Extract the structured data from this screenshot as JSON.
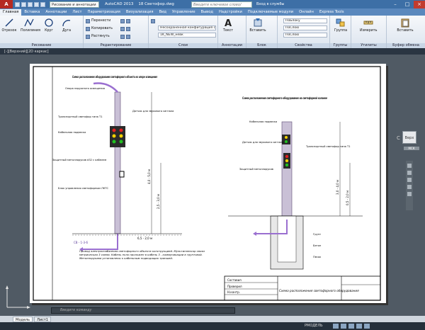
{
  "titlebar": {
    "logo": "A",
    "workspace": "Рисование и аннотации",
    "window_title_app": "AutoCAD 2013",
    "window_title_file": "18 Светофор.dwg",
    "search_placeholder": "Введите ключевое слово/фразу",
    "login": "Вход в службы"
  },
  "tabs": [
    "Главная",
    "Вставка",
    "Аннотации",
    "Лист",
    "Параметризация",
    "Визуализация",
    "Вид",
    "Управление",
    "Вывод",
    "Надстройки",
    "Подключаемые модули",
    "Онлайн",
    "Express Tools"
  ],
  "ribbon": {
    "draw": {
      "title": "Рисование",
      "line": "Отрезок",
      "polyline": "Полилиния",
      "circle": "Круг",
      "arc": "Дуга"
    },
    "modify": {
      "title": "Редактирование",
      "move": "Перенести",
      "copy": "Копировать",
      "stretch": "Растянуть"
    },
    "layers": {
      "title": "Слои",
      "layer_state": "Несохраненная конфигурация сло",
      "current_layer": "1K_NEW_невк"
    },
    "annotation": {
      "title": "Аннотации",
      "text": "Текст"
    },
    "block": {
      "title": "Блок",
      "insert": "Вставить"
    },
    "properties": {
      "title": "Свойства",
      "color": "ПоБлоку",
      "linetype": "ПоСлою",
      "lineweight": "ПоСлою"
    },
    "groups": {
      "title": "Группы",
      "group": "Группа"
    },
    "utilities": {
      "title": "Утилиты",
      "measure": "Измерить"
    },
    "clipboard": {
      "title": "Буфер обмена",
      "paste": "Вставить"
    }
  },
  "doc_view_label": "[-][Верхний][2D каркас]",
  "viewcube": {
    "north": "С",
    "face": "Верх",
    "wcs": "МСК"
  },
  "drawing": {
    "left_title": "Схема расположения оборудования светофорного объекта на опоре освещения",
    "right_title": "Схема расположения светофорного оборудования на светофорной колонке",
    "left_labels": [
      "Опора наружного освещения",
      "Транспортный светофор типа Т1",
      "Кабельная подвеска",
      "Защитный металлорукав d32 с кабелем",
      "Блок управления светофорным ЛКТС",
      "Датчик для звукового сигнала"
    ],
    "right_labels": [
      "Кабельная подвеска",
      "Датчик для звукового сигнала",
      "Транспортный светофор типа Т1",
      "Защитный металлорукав"
    ],
    "dims": [
      "6,5 - 7,0 м",
      "2,5 - 3,0 м",
      "4,0 - 5,0 м",
      "3,0 - 4,0 м",
      "6,5 - 2,0 м",
      "0,5 - 2,0 м"
    ],
    "notes": "Провод электроснабжения светофорного объекта конструкцией. Мультиплексор связи метрическая 3 схема. Кабель поло проложен в кабель 3 - коммуникации в грунтовой. Металлорукава установлены к кабельным подводящих траншей.",
    "stamp_title": "Схема расположения светофорного оборудования",
    "stamp_labels": [
      "Составил",
      "Проверил",
      "Н.контр."
    ],
    "cable_tag": "СВ - 1-3-6",
    "ground_labels": [
      "Грунт",
      "Бетон",
      "Песок"
    ]
  },
  "cmdline": {
    "placeholder": "Введите команду"
  },
  "layout_tabs": [
    "Модель",
    "Лист1"
  ],
  "status": {
    "mode": "РМОДЕЛЬ"
  }
}
